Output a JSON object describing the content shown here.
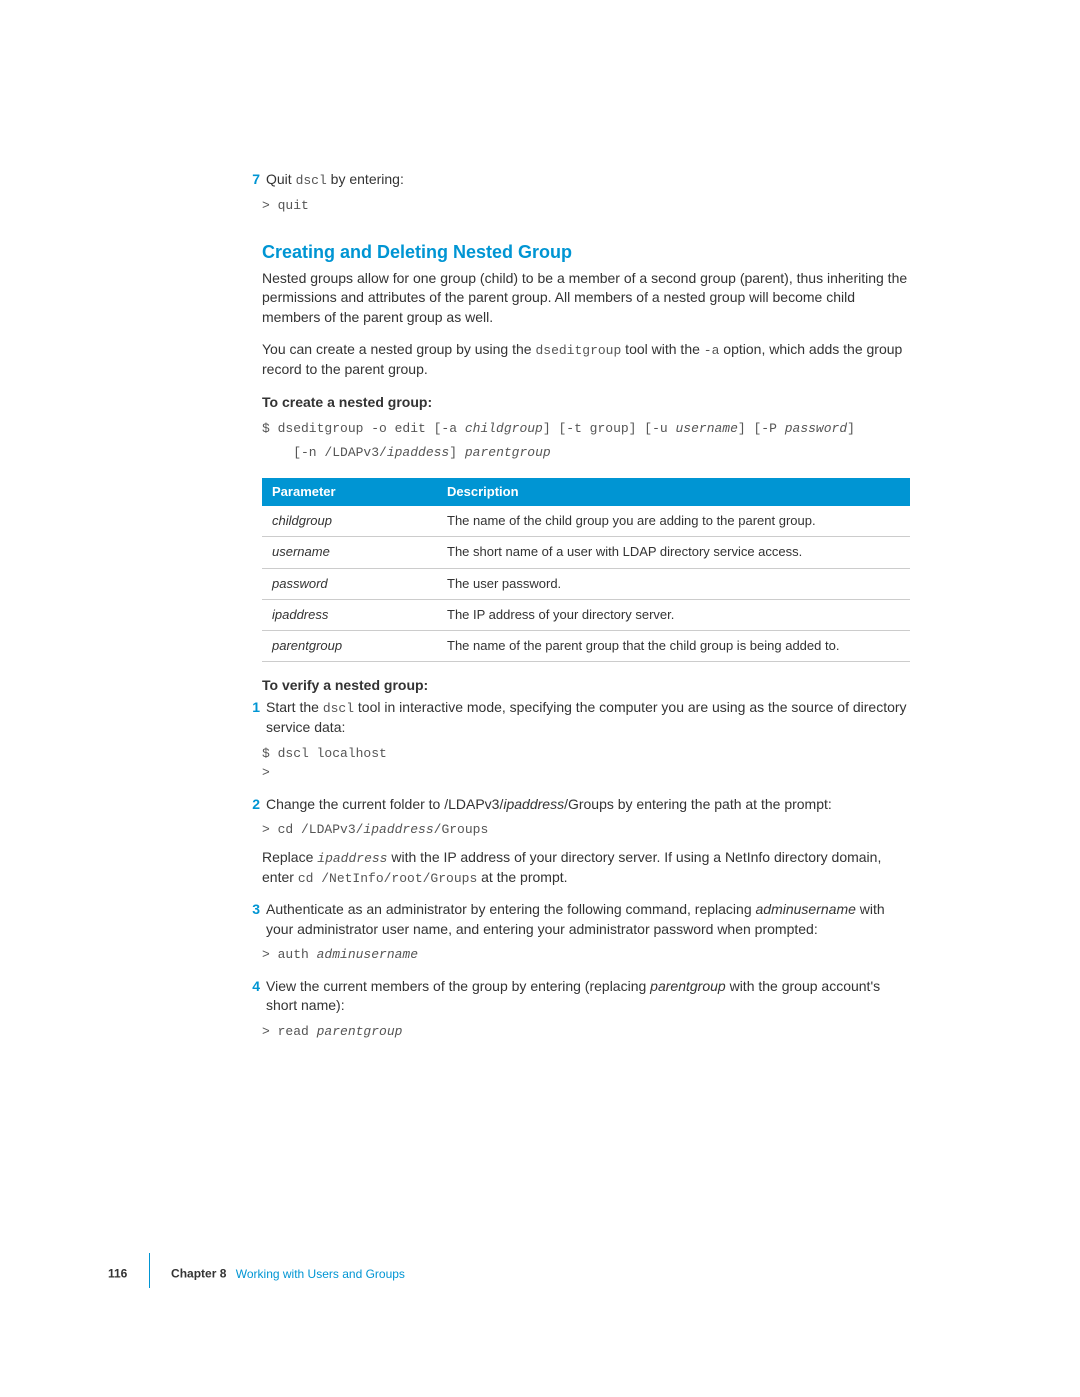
{
  "step7": {
    "num": "7",
    "prefix": "Quit ",
    "cmd": "dscl",
    "suffix": " by entering:",
    "code": "> quit"
  },
  "sectionTitle": "Creating and Deleting Nested Group",
  "para1": "Nested groups allow for one group (child) to be a member of a second group (parent), thus inheriting the permissions and attributes of the parent group. All members of a nested group will become child members of the parent group as well.",
  "para2a": "You can create a nested group by using the ",
  "para2cmd": "dseditgroup",
  "para2b": " tool with the ",
  "para2opt": "-a",
  "para2c": " option, which adds the group record to the parent group.",
  "createTitle": "To create a nested group:",
  "createCode1": "$ dseditgroup -o edit [-a ",
  "createCode1i": "childgroup",
  "createCode1b": "] [-t group] [-u ",
  "createCode1i2": "username",
  "createCode1c": "] [-P ",
  "createCode1i3": "password",
  "createCode1d": "]",
  "createCode2a": "    [-n /LDAPv3/",
  "createCode2i": "ipaddess",
  "createCode2b": "] ",
  "createCode2i2": "parentgroup",
  "table": {
    "hParam": "Parameter",
    "hDesc": "Description",
    "rows": [
      {
        "param": "childgroup",
        "desc": "The name of the child group you are adding to the parent group."
      },
      {
        "param": "username",
        "desc": "The short name of a user with LDAP directory service access."
      },
      {
        "param": "password",
        "desc": "The user password."
      },
      {
        "param": "ipaddress",
        "desc": "The IP address of your directory server."
      },
      {
        "param": "parentgroup",
        "desc": "The name of the parent group that the child group is being added to."
      }
    ]
  },
  "verifyTitle": "To verify a nested group:",
  "vstep1": {
    "num": "1",
    "a": "Start the ",
    "cmd": "dscl",
    "b": " tool in interactive mode, specifying the computer you are using as the source of directory service data:",
    "code": "$ dscl localhost\n>"
  },
  "vstep2": {
    "num": "2",
    "a": "Change the current folder to /LDAPv3/",
    "i": "ipaddress",
    "b": "/Groups by entering the path at the prompt:",
    "code1": "> cd /LDAPv3/",
    "codei": "ipaddress",
    "code2": "/Groups",
    "post1": "Replace ",
    "posti": "ipaddress",
    "post2": " with the IP address of your directory server. If using a NetInfo directory domain, enter ",
    "post_cmd": "cd /NetInfo/root/Groups",
    "post3": " at the prompt."
  },
  "vstep3": {
    "num": "3",
    "a": "Authenticate as an administrator by entering the following command, replacing ",
    "i": "adminusername",
    "b": " with your administrator user name, and entering your administrator password when prompted:",
    "code1": "> auth ",
    "codei": "adminusername"
  },
  "vstep4": {
    "num": "4",
    "a": "View the current members of the group by entering (replacing ",
    "i": "parentgroup",
    "b": " with the group account's short name):",
    "code1": "> read ",
    "codei": "parentgroup"
  },
  "footer": {
    "page": "116",
    "chapterLabel": "Chapter 8",
    "chapterTitle": "Working with Users and Groups"
  }
}
